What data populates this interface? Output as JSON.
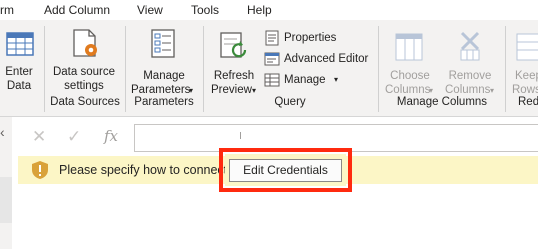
{
  "menubar": {
    "items": [
      "rm",
      "Add Column",
      "View",
      "Tools",
      "Help"
    ]
  },
  "ribbon": {
    "enter_data": {
      "label": "Enter\nData",
      "line1": "Enter",
      "line2": "Data"
    },
    "data_source_settings": {
      "line1": "Data source",
      "line2": "settings"
    },
    "manage_parameters": {
      "line1": "Manage",
      "line2": "Parameters"
    },
    "refresh_preview": {
      "line1": "Refresh",
      "line2": "Preview"
    },
    "properties": "Properties",
    "advanced_editor": "Advanced Editor",
    "manage": "Manage",
    "choose_columns": {
      "line1": "Choose",
      "line2": "Columns"
    },
    "remove_columns": {
      "line1": "Remove",
      "line2": "Columns"
    },
    "keep_rows": {
      "line1": "Keep",
      "line2": "Rows"
    },
    "groups": {
      "data_sources": "Data Sources",
      "parameters": "Parameters",
      "query": "Query",
      "manage_columns": "Manage Columns",
      "reduce": "Red"
    }
  },
  "formula_bar": {
    "cancel_icon": "close-icon",
    "commit_icon": "check-icon",
    "fx_label": "fx",
    "value": ""
  },
  "warning": {
    "message": "Please specify how to connect.",
    "button_label": "Edit Credentials"
  },
  "colors": {
    "ribbon_bg": "#f3f2f1",
    "warning_bg": "#fcf6c6",
    "highlight": "#ff2a0f",
    "icon_blue": "#4a78b8",
    "icon_orange": "#e07b1f",
    "icon_green": "#3a8a3a"
  }
}
